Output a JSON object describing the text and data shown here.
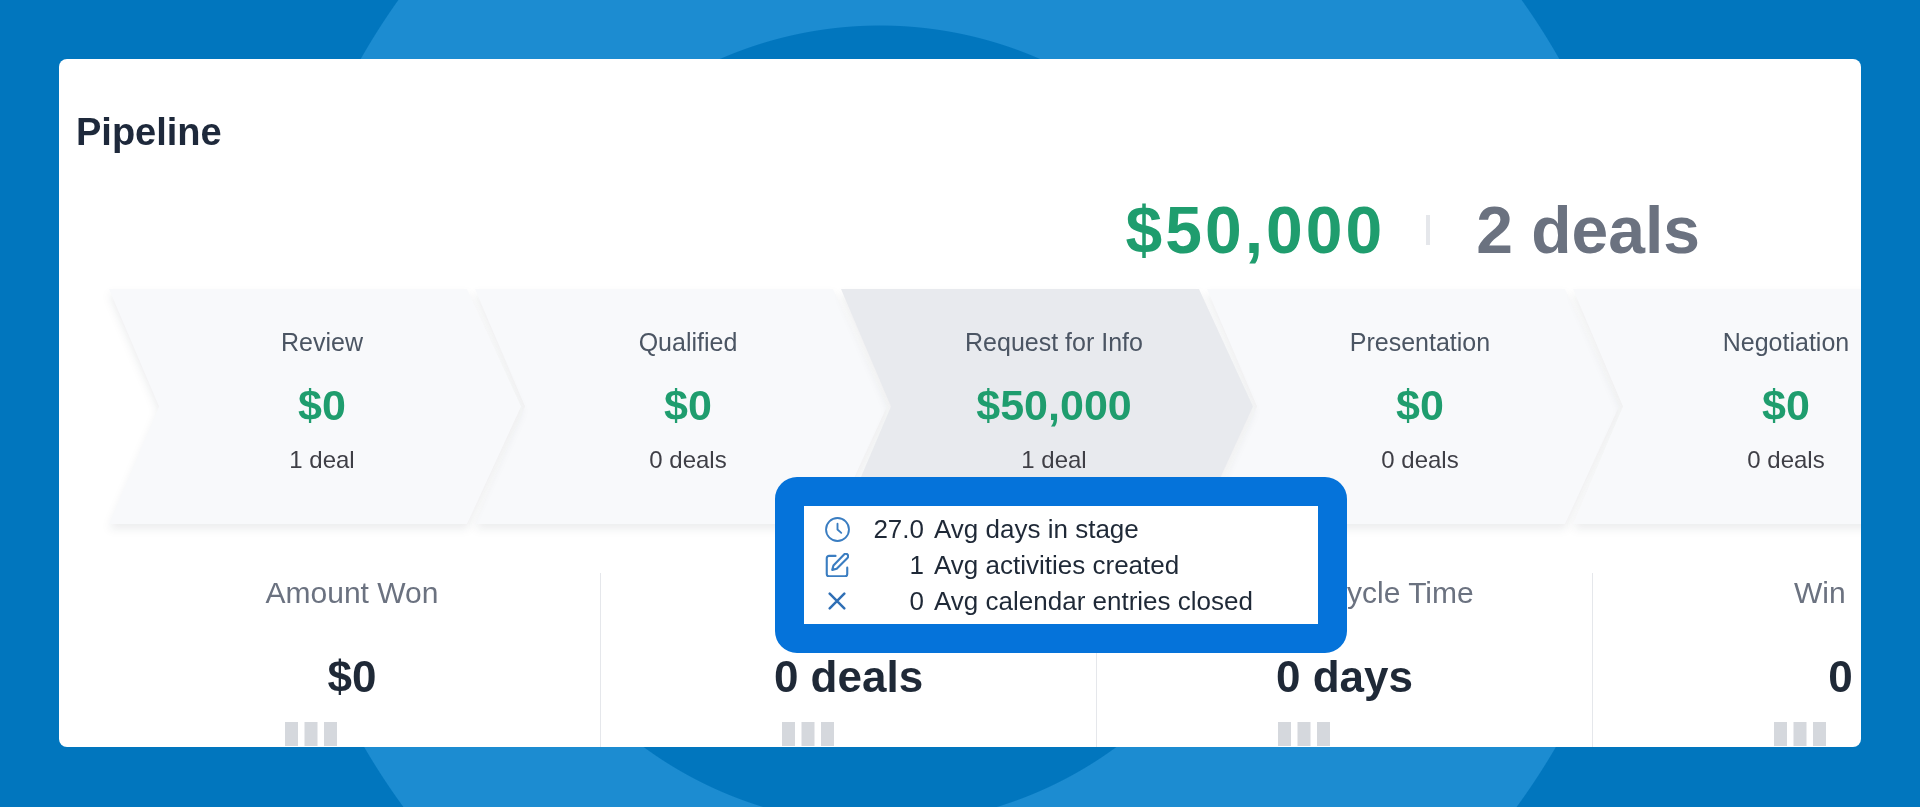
{
  "title": "Pipeline",
  "summary": {
    "amount": "$50,000",
    "deals": "2 deals"
  },
  "stages": [
    {
      "name": "Review",
      "amount": "$0",
      "deals": "1 deal",
      "selected": false
    },
    {
      "name": "Qualified",
      "amount": "$0",
      "deals": "0 deals",
      "selected": false
    },
    {
      "name": "Request for Info",
      "amount": "$50,000",
      "deals": "1 deal",
      "selected": true
    },
    {
      "name": "Presentation",
      "amount": "$0",
      "deals": "0 deals",
      "selected": false
    },
    {
      "name": "Negotiation",
      "amount": "$0",
      "deals": "0 deals",
      "selected": false
    }
  ],
  "tooltip": {
    "rows": [
      {
        "kind": "days",
        "stat": "27.0",
        "description": "Avg days in stage"
      },
      {
        "kind": "activities",
        "stat": "1",
        "description": "Avg activities created"
      },
      {
        "kind": "entries",
        "stat": "0",
        "description": "Avg calendar entries closed"
      }
    ]
  },
  "metrics": [
    {
      "kind": "whole",
      "label": "Amount Won",
      "value": "$0"
    },
    {
      "kind": "whole",
      "value": "0 deals"
    },
    {
      "kind": "tail",
      "label": "ycle Time",
      "value": "0 days"
    },
    {
      "kind": "head",
      "label": "Win",
      "value": "0"
    }
  ]
}
